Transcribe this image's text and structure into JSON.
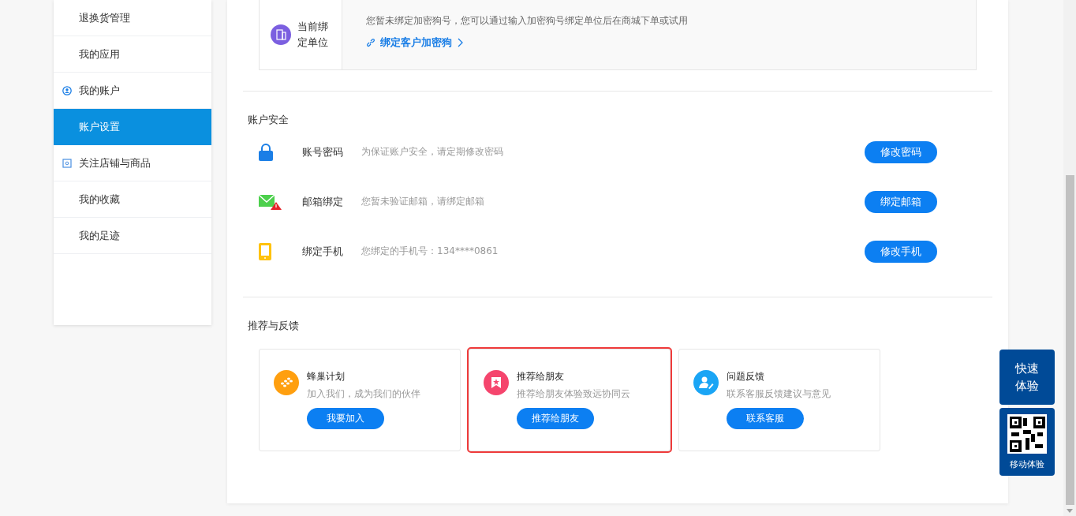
{
  "sidebar": {
    "items": [
      {
        "label": "退换货管理",
        "kind": "item",
        "selected": false
      },
      {
        "label": "我的应用",
        "kind": "item",
        "selected": false
      },
      {
        "label": "我的账户",
        "kind": "header",
        "selected": false
      },
      {
        "label": "账户设置",
        "kind": "item",
        "selected": true
      },
      {
        "label": "关注店铺与商品",
        "kind": "header",
        "selected": false
      },
      {
        "label": "我的收藏",
        "kind": "item",
        "selected": false
      },
      {
        "label": "我的足迹",
        "kind": "item",
        "selected": false
      }
    ]
  },
  "binding": {
    "label": "当前绑定单位",
    "message": "您暂未绑定加密狗号，您可以通过输入加密狗号绑定单位后在商城下单或试用",
    "link": "绑定客户加密狗"
  },
  "security": {
    "title": "账户安全",
    "rows": [
      {
        "name": "账号密码",
        "desc": "为保证账户安全，请定期修改密码",
        "button": "修改密码"
      },
      {
        "name": "邮箱绑定",
        "desc": "您暂未验证邮箱，请绑定邮箱",
        "button": "绑定邮箱"
      },
      {
        "name": "绑定手机",
        "desc": "您绑定的手机号：134****0861",
        "button": "修改手机"
      }
    ]
  },
  "feedback": {
    "title": "推荐与反馈",
    "cards": [
      {
        "color": "#ff9f0f",
        "title": "蜂巢计划",
        "desc": "加入我们，成为我们的伙伴",
        "button": "我要加入",
        "highlighted": false
      },
      {
        "color": "#f5456d",
        "title": "推荐给朋友",
        "desc": "推荐给朋友体验致远协同云",
        "button": "推荐给朋友",
        "highlighted": true
      },
      {
        "color": "#1aa5f5",
        "title": "问题反馈",
        "desc": "联系客服反馈建议与意见",
        "button": "联系客服",
        "highlighted": false
      }
    ]
  },
  "float": {
    "quick": "快速体验",
    "mobile": "移动体验"
  }
}
